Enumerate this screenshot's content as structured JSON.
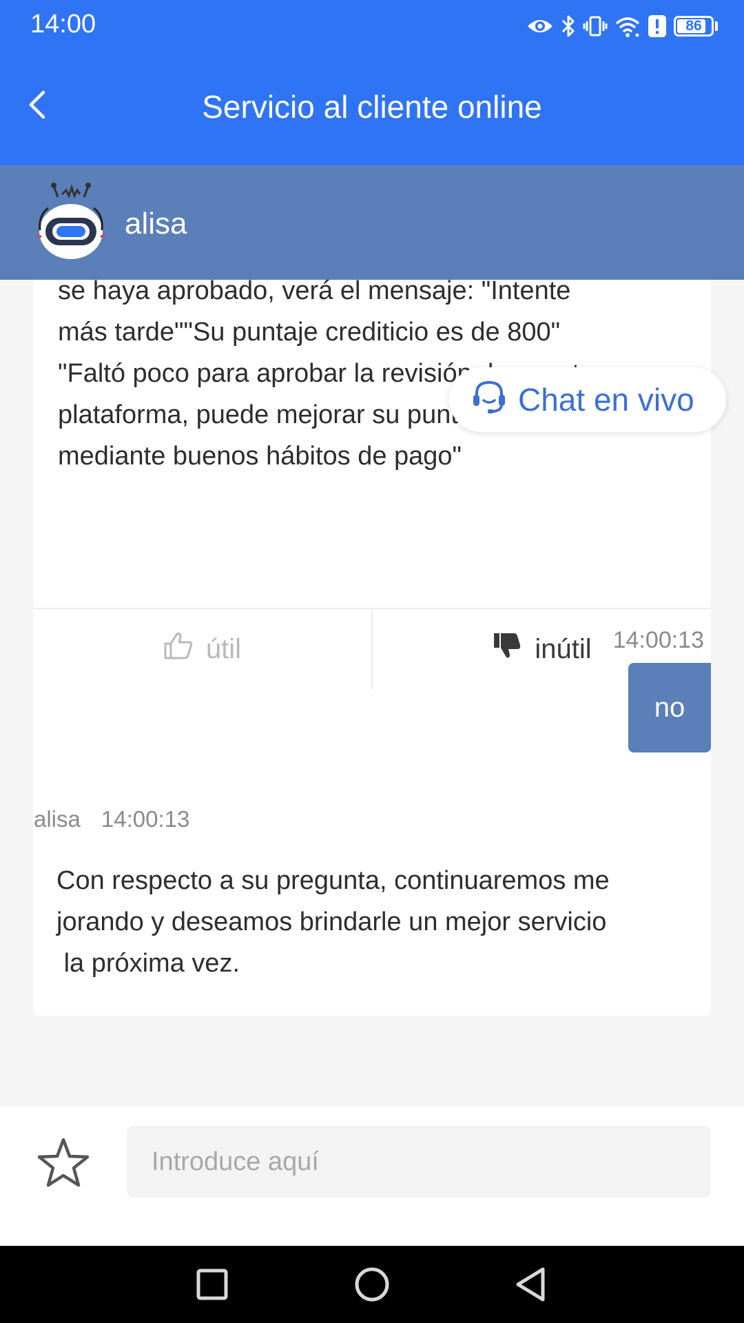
{
  "status_bar": {
    "time": "14:00",
    "battery_level": "86",
    "battery_percent": 86,
    "icons": [
      "eye-icon",
      "bluetooth-icon",
      "vibrate-icon",
      "wifi-icon",
      "alert-icon",
      "battery-icon"
    ]
  },
  "header": {
    "title": "Servicio al cliente online",
    "back_icon": "chevron-left-icon"
  },
  "agent": {
    "name": "alisa",
    "avatar_icon": "robot-avatar-icon"
  },
  "messages": {
    "bot_card": {
      "lines": [
        "se haya aprobado, verá el mensaje: \"Intente",
        "más tarde\"\"Su puntaje crediticio es de 800\"",
        "\"Faltó poco para aprobar la revisión de nuestra",
        "plataforma, puede mejorar su puntaje crediticio",
        "mediante buenos hábitos de pago\""
      ],
      "useful_label": "útil",
      "useless_label": "inútil"
    },
    "user_message": {
      "time": "14:00:13",
      "text": "no"
    },
    "bot_message": {
      "sender": "alisa",
      "time": "14:00:13",
      "text": "Con respecto a su pregunta, continuaremos me\njorando y deseamos brindarle un mejor servicio\n la próxima vez."
    }
  },
  "live_chat": {
    "label": "Chat en vivo",
    "icon": "headset-icon"
  },
  "input": {
    "placeholder": "Introduce aquí",
    "value": "",
    "favorite_icon": "star-icon"
  },
  "nav_bar": {
    "icons": [
      "square-recents-icon",
      "circle-home-icon",
      "triangle-back-icon"
    ]
  },
  "colors": {
    "primary": "#2e74f5",
    "agent_header": "#5b7fb8",
    "user_bubble": "#5b7fb8",
    "live_chat_text": "#3d6fd2",
    "background": "#f5f5f6"
  }
}
